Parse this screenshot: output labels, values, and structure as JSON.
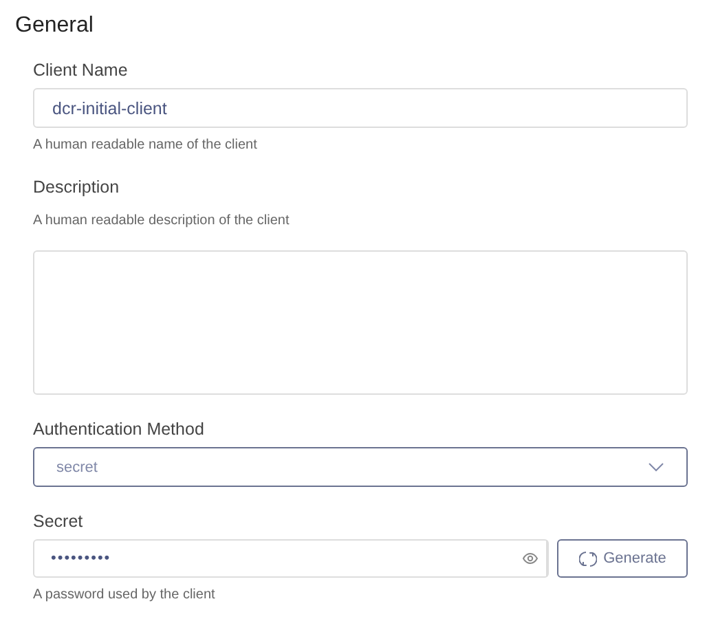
{
  "section": {
    "title": "General"
  },
  "fields": [
    {
      "kind": "text",
      "label": "Client Name",
      "value": "dcr-initial-client",
      "help": "A human readable name of the client"
    },
    {
      "kind": "textarea",
      "label": "Description",
      "help": "A human readable description of the client"
    },
    {
      "kind": "select",
      "label": "Authentication Method",
      "value": "secret",
      "focused": true
    },
    {
      "kind": "password",
      "label": "Secret",
      "value": "•••••••••",
      "button": "Generate",
      "help": "A password used by the client"
    }
  ]
}
